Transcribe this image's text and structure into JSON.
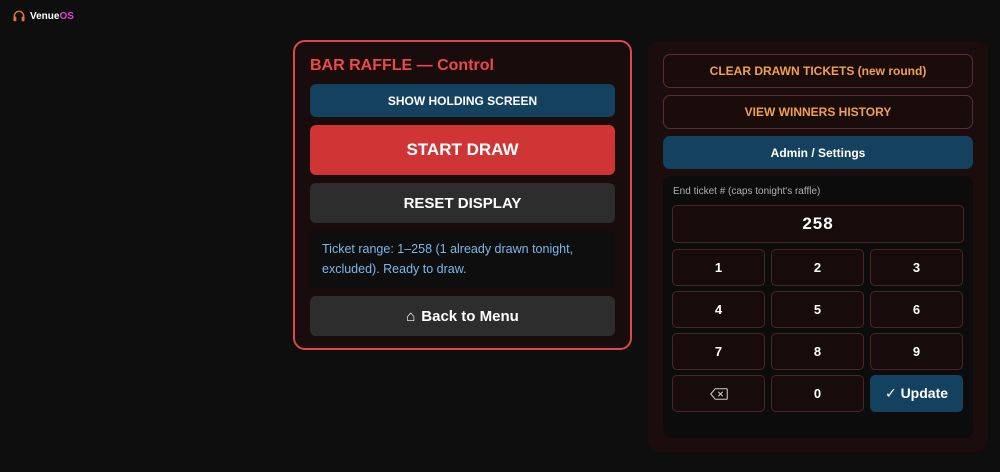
{
  "app": {
    "logo_part1": "Venue",
    "logo_part2": "OS"
  },
  "control": {
    "title": "BAR RAFFLE — Control",
    "holding_label": "SHOW HOLDING SCREEN",
    "start_label": "START DRAW",
    "reset_label": "RESET DISPLAY",
    "status_text": "Ticket range: 1–258 (1 already drawn tonight, excluded). Ready to draw.",
    "back_icon": "⌂",
    "back_label": "Back to Menu"
  },
  "admin": {
    "clear_label": "CLEAR DRAWN TICKETS (new round)",
    "history_label": "VIEW WINNERS HISTORY",
    "settings_label": "Admin / Settings",
    "keypad_label": "End ticket # (caps tonight's raffle)",
    "ticket_value": "258",
    "keys": [
      "1",
      "2",
      "3",
      "4",
      "5",
      "6",
      "7",
      "8",
      "9"
    ],
    "zero_key": "0",
    "update_label": "✓ Update"
  },
  "colors": {
    "accent_red": "#d03535",
    "accent_blue": "#14415e",
    "accent_orange": "#f0a050",
    "status_blue": "#7bb8ea"
  },
  "icons": {
    "logo": "headphones-icon",
    "back": "home-icon",
    "backspace": "backspace-icon"
  }
}
